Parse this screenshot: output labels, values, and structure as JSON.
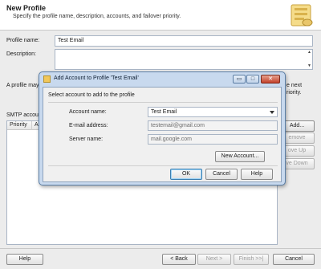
{
  "wizard": {
    "title": "New Profile",
    "subtitle": "Specify the profile name, description, accounts, and failover priority.",
    "profile_name_label": "Profile name:",
    "profile_name_value": "Test Email",
    "description_label": "Description:",
    "description_value": "",
    "side_text_left": "A profile may",
    "side_text_right_1": "e next",
    "side_text_right_2": "riority.",
    "smtp_label": "SMTP accou",
    "grid_columns": [
      "Priority",
      "A"
    ],
    "side_buttons": {
      "add": "Add...",
      "remove": "emove",
      "move_up": "ove Up",
      "move_down": "ve Down"
    },
    "footer": {
      "help": "Help",
      "back": "< Back",
      "next": "Next >",
      "finish": "Finish >>|",
      "cancel": "Cancel"
    }
  },
  "dialog": {
    "title": "Add Account to Profile 'Test Email'",
    "instruction": "Select account to add to the profile",
    "account_name_label": "Account name:",
    "account_name_value": "Test Email",
    "email_label": "E-mail address:",
    "email_value": "testemail@gmail.com",
    "server_label": "Server name:",
    "server_value": "mail.google.com",
    "new_account_button": "New Account...",
    "ok": "OK",
    "cancel": "Cancel",
    "help": "Help",
    "caption_buttons": {
      "minimize": "▭",
      "maximize": "□",
      "close": "✕"
    }
  },
  "colors": {
    "dialog_frame": "#c8d9ee",
    "default_button_border": "#3c7fb1"
  }
}
